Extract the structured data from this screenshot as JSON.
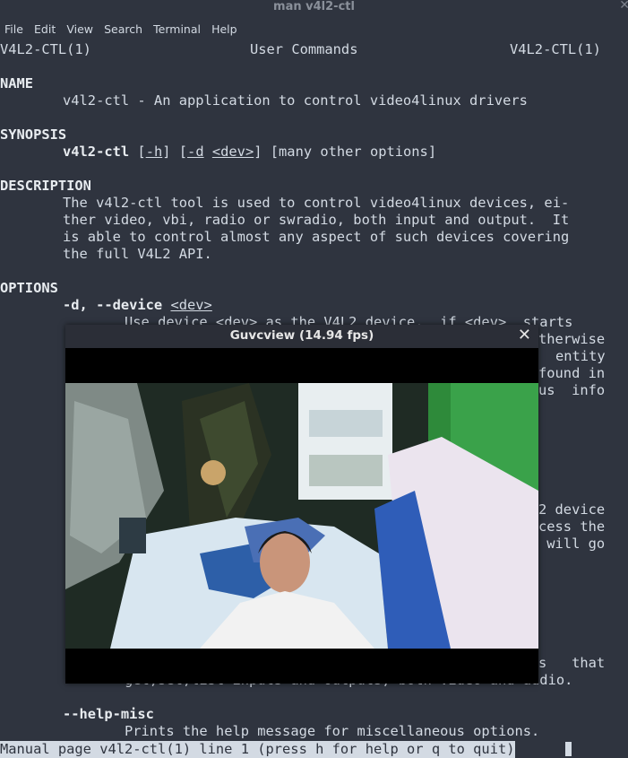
{
  "window": {
    "title": "man v4l2-ctl"
  },
  "menu": [
    "File",
    "Edit",
    "View",
    "Search",
    "Terminal",
    "Help"
  ],
  "man": {
    "header_left": "V4L2-CTL(1)",
    "header_center": "User Commands",
    "header_right": "V4L2-CTL(1)",
    "name_heading": "NAME",
    "name_line": "v4l2-ctl - An application to control video4linux drivers",
    "synopsis_heading": "SYNOPSIS",
    "synopsis_cmd": "v4l2-ctl",
    "synopsis_h": "-h",
    "synopsis_d": "-d",
    "synopsis_dev": "<dev>",
    "synopsis_rest": "[many other options]",
    "description_heading": "DESCRIPTION",
    "description_lines": [
      "The v4l2-ctl tool is used to control video4linux devices, ei-",
      "ther video, vbi, radio or swradio, both input and output.  It",
      "is able to control almost any aspect of such devices covering",
      "the full V4L2 API."
    ],
    "options_heading": "OPTIONS",
    "device_opt": "-d, --device",
    "device_arg": "<dev>",
    "device_desc_partial": [
      "Use device <dev> as the V4L2 device.  if <dev>  starts",
      "therwise",
      "entity",
      "found in",
      "us  info"
    ],
    "partial_mid": [
      "2 device",
      "cess the",
      " will go"
    ],
    "partial_low1": "s   that",
    "partial_low2": "get,set,list inputs and outputs, both video and audio.",
    "help_misc": "--help-misc",
    "help_misc_desc": "Prints the help message for miscellaneous options.",
    "status": "Manual page v4l2-ctl(1) line 1 (press h for help or q to quit)"
  },
  "guvcview": {
    "title": "Guvcview  (14.94 fps)",
    "close": "✕"
  }
}
